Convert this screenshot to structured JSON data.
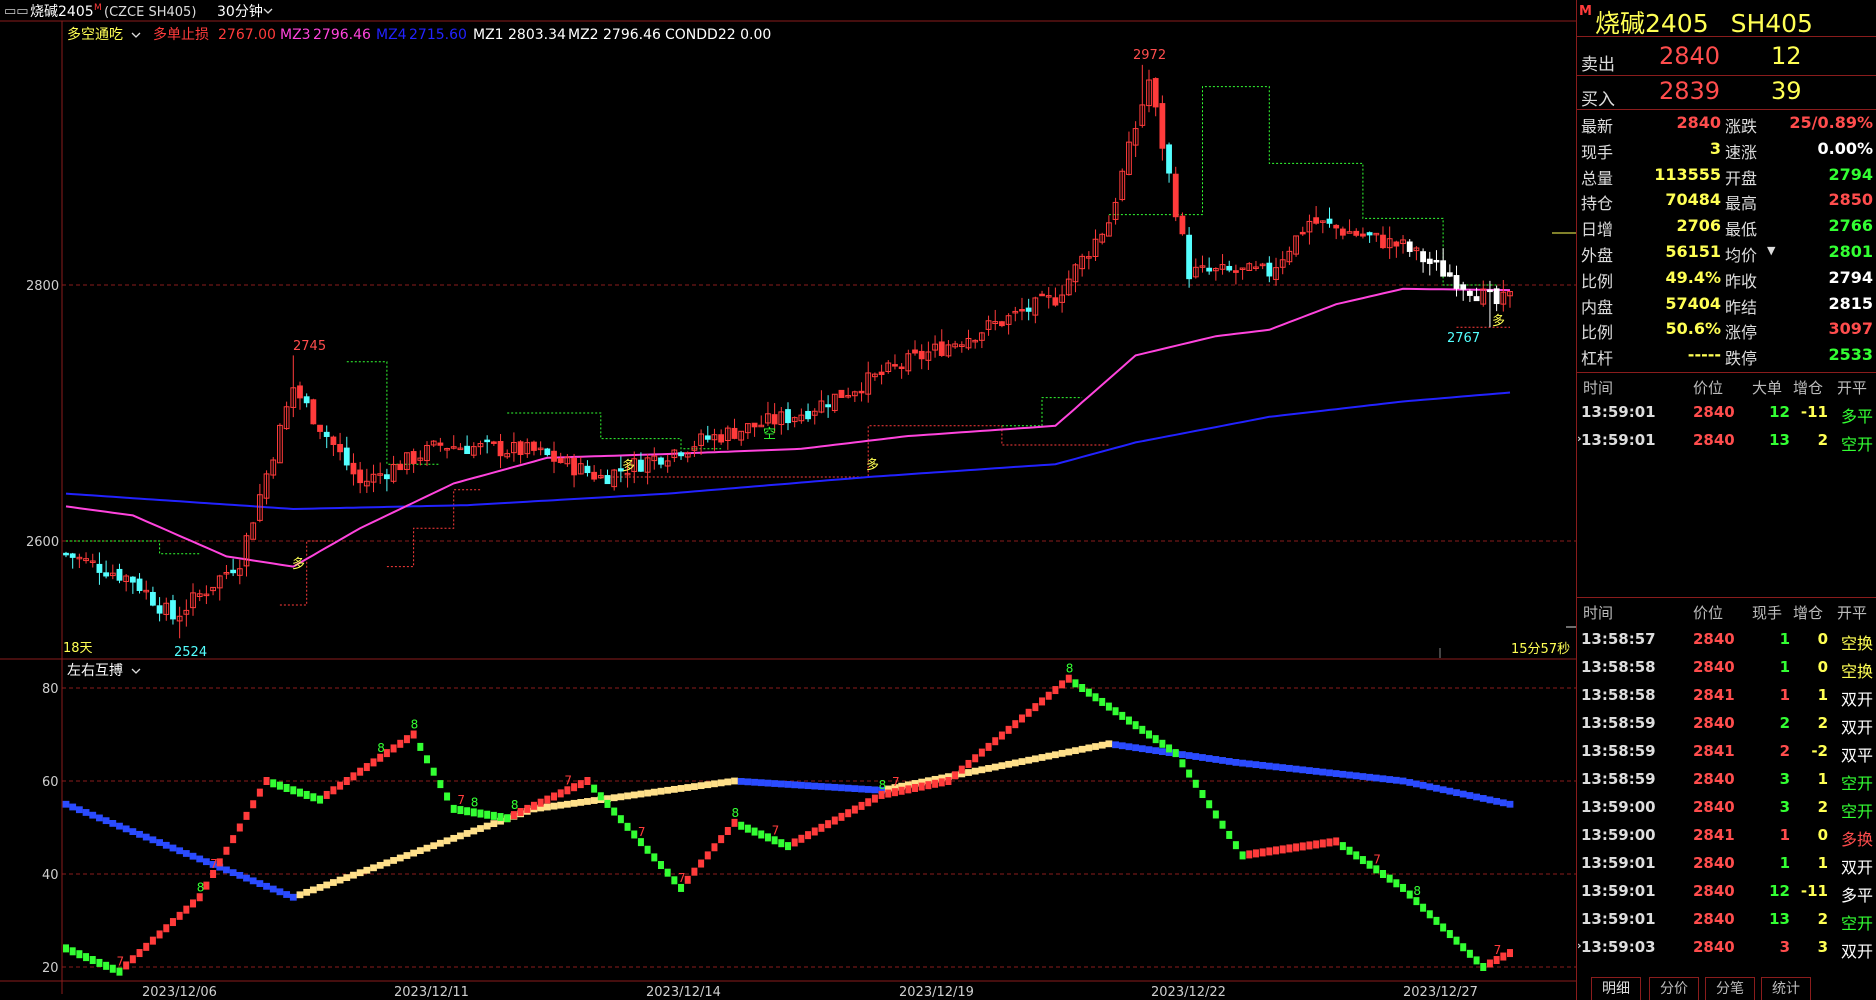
{
  "window": {
    "title_prefix": "烧碱2405",
    "title_suffix": "(CZCE SH405)",
    "period": "30分钟"
  },
  "colors": {
    "up": "#ff3b3b",
    "down": "#54ffff",
    "ma3": "#ff44dd",
    "ma4": "#2222ff",
    "yellow": "#ffff54",
    "green": "#33ff33",
    "grid": "#8a1c1c"
  },
  "indicator_line": {
    "name": "多空通吃",
    "stop_label": "多单止损",
    "stop_value": "2767.00",
    "mz3_label": "MZ3",
    "mz3_value": "2796.46",
    "mz4_label": "MZ4",
    "mz4_value": "2715.60",
    "mz1": "MZ1 2803.34",
    "mz2": "MZ2 2796.46",
    "cond": "CONDD22 0.00"
  },
  "main_chart": {
    "y_ticks": [
      "2800",
      "2600"
    ],
    "max_label": "2972",
    "local_max_label": "2745",
    "min_label": "2524",
    "recent_low_label": "2767",
    "days_label": "18天",
    "countdown": "15分57秒",
    "signal_long": "多",
    "signal_short": "空"
  },
  "sub_chart": {
    "name": "左右互搏",
    "y_ticks": [
      "80",
      "60",
      "40",
      "20"
    ]
  },
  "x_dates": [
    "2023/12/06",
    "2023/12/11",
    "2023/12/14",
    "2023/12/19",
    "2023/12/22",
    "2023/12/27"
  ],
  "chart_data": [
    {
      "type": "candlestick",
      "title": "烧碱2405 (CZCE SH405) 30分钟",
      "y_ticks": [
        2600,
        2800
      ],
      "ohlc_keypoints": [
        [
          0,
          2590
        ],
        [
          10,
          2570
        ],
        [
          16,
          2540
        ],
        [
          26,
          2585
        ],
        [
          34,
          2720
        ],
        [
          44,
          2645
        ],
        [
          56,
          2675
        ],
        [
          70,
          2670
        ],
        [
          80,
          2650
        ],
        [
          96,
          2680
        ],
        [
          110,
          2700
        ],
        [
          126,
          2740
        ],
        [
          148,
          2790
        ],
        [
          156,
          2850
        ],
        [
          162,
          2960
        ],
        [
          168,
          2810
        ],
        [
          180,
          2810
        ],
        [
          186,
          2850
        ],
        [
          200,
          2830
        ],
        [
          214,
          2785
        ],
        [
          220,
          2800
        ],
        [
          226,
          2840
        ]
      ],
      "annotations": {
        "high": 2972,
        "peak2": 2745,
        "low": 2524,
        "recent_low": 2767
      },
      "series": [
        {
          "name": "MZ3",
          "last": 2796.46
        },
        {
          "name": "MZ4",
          "last": 2715.6
        },
        {
          "name": "MZ1",
          "last": 2803.34
        },
        {
          "name": "MZ2",
          "last": 2796.46
        },
        {
          "name": "多单止损",
          "last": 2767.0
        }
      ]
    },
    {
      "type": "line",
      "title": "左右互搏",
      "y_ticks": [
        80,
        60,
        40,
        20
      ],
      "series": [
        {
          "values_keypoints": [
            [
              0,
              24
            ],
            [
              8,
              19
            ],
            [
              20,
              35
            ],
            [
              30,
              60
            ],
            [
              38,
              56
            ],
            [
              52,
              70
            ],
            [
              58,
              54
            ],
            [
              66,
              52
            ],
            [
              78,
              60
            ],
            [
              92,
              37
            ],
            [
              100,
              51
            ],
            [
              108,
              46
            ],
            [
              122,
              57
            ],
            [
              132,
              60
            ],
            [
              150,
              82
            ],
            [
              166,
              66
            ],
            [
              176,
              44
            ],
            [
              190,
              47
            ],
            [
              200,
              37
            ],
            [
              212,
              20
            ],
            [
              216,
              23
            ]
          ]
        },
        {
          "values_keypoints": [
            [
              0,
              55
            ],
            [
              34,
              35
            ],
            [
              70,
              54
            ],
            [
              100,
              60
            ],
            [
              122,
              58
            ],
            [
              156,
              68
            ],
            [
              175,
              64
            ],
            [
              200,
              60
            ],
            [
              216,
              55
            ]
          ]
        }
      ]
    }
  ],
  "quote": {
    "symbol": "烧碱2405",
    "code": "SH405",
    "flag": "M",
    "ask_label": "卖出",
    "ask_price": "2840",
    "ask_vol": "12",
    "bid_label": "买入",
    "bid_price": "2839",
    "bid_vol": "39",
    "rows": [
      {
        "k1": "最新",
        "v1": "2840",
        "c1": "#ff4d4d",
        "k2": "涨跌",
        "v2": "25/0.89%",
        "c2": "#ff4d4d"
      },
      {
        "k1": "现手",
        "v1": "3",
        "c1": "#ffff54",
        "k2": "速涨",
        "v2": "0.00%",
        "c2": "#ffffff"
      },
      {
        "k1": "总量",
        "v1": "113555",
        "c1": "#ffff54",
        "k2": "开盘",
        "v2": "2794",
        "c2": "#33ff33"
      },
      {
        "k1": "持仓",
        "v1": "70484",
        "c1": "#ffff54",
        "k2": "最高",
        "v2": "2850",
        "c2": "#ff4d4d"
      },
      {
        "k1": "日增",
        "v1": "2706",
        "c1": "#ffff54",
        "k2": "最低",
        "v2": "2766",
        "c2": "#33ff33"
      },
      {
        "k1": "外盘",
        "v1": "56151",
        "c1": "#ffff54",
        "k2": "均价",
        "v2": "2801",
        "c2": "#33ff33"
      },
      {
        "k1": "比例",
        "v1": "49.4%",
        "c1": "#ffff54",
        "k2": "昨收",
        "v2": "2794",
        "c2": "#ffffff"
      },
      {
        "k1": "内盘",
        "v1": "57404",
        "c1": "#ffff54",
        "k2": "昨结",
        "v2": "2815",
        "c2": "#ffffff"
      },
      {
        "k1": "比例",
        "v1": "50.6%",
        "c1": "#ffff54",
        "k2": "涨停",
        "v2": "3097",
        "c2": "#ff4d4d"
      },
      {
        "k1": "杠杆",
        "v1": "-----",
        "c1": "#ffff54",
        "k2": "跌停",
        "v2": "2533",
        "c2": "#33ff33"
      }
    ]
  },
  "big_header": {
    "time": "时间",
    "price": "价位",
    "vol": "大单",
    "chg": "增仓",
    "type": "开平"
  },
  "big_trades": [
    {
      "time": "13:59:01",
      "price": "2840",
      "vol": "12",
      "chg": "-11",
      "type": "多平",
      "vc": "#33ff33",
      "cc": "#ffff54",
      "tc": "#33ff33"
    },
    {
      "time": "13:59:01",
      "price": "2840",
      "vol": "13",
      "chg": "2",
      "type": "空开",
      "vc": "#33ff33",
      "cc": "#ffff54",
      "tc": "#33ff33"
    }
  ],
  "tick_header": {
    "time": "时间",
    "price": "价位",
    "vol": "现手",
    "chg": "增仓",
    "type": "开平"
  },
  "ticks": [
    {
      "time": "13:58:57",
      "price": "2840",
      "vol": "1",
      "chg": "0",
      "type": "空换",
      "vc": "#33ff33",
      "cc": "#ffff54",
      "tc": "#ffff54"
    },
    {
      "time": "13:58:58",
      "price": "2840",
      "vol": "1",
      "chg": "0",
      "type": "空换",
      "vc": "#33ff33",
      "cc": "#ffff54",
      "tc": "#ffff54"
    },
    {
      "time": "13:58:58",
      "price": "2841",
      "vol": "1",
      "chg": "1",
      "type": "双开",
      "vc": "#ff4d4d",
      "cc": "#ffff54",
      "tc": "#ffffff"
    },
    {
      "time": "13:58:59",
      "price": "2840",
      "vol": "2",
      "chg": "2",
      "type": "双开",
      "vc": "#33ff33",
      "cc": "#ffff54",
      "tc": "#ffffff"
    },
    {
      "time": "13:58:59",
      "price": "2841",
      "vol": "2",
      "chg": "-2",
      "type": "双平",
      "vc": "#ff4d4d",
      "cc": "#ffff54",
      "tc": "#ffffff"
    },
    {
      "time": "13:58:59",
      "price": "2840",
      "vol": "3",
      "chg": "1",
      "type": "空开",
      "vc": "#33ff33",
      "cc": "#ffff54",
      "tc": "#33ff33"
    },
    {
      "time": "13:59:00",
      "price": "2840",
      "vol": "3",
      "chg": "2",
      "type": "空开",
      "vc": "#33ff33",
      "cc": "#ffff54",
      "tc": "#33ff33"
    },
    {
      "time": "13:59:00",
      "price": "2841",
      "vol": "1",
      "chg": "0",
      "type": "多换",
      "vc": "#ff4d4d",
      "cc": "#ffff54",
      "tc": "#ff4d4d"
    },
    {
      "time": "13:59:01",
      "price": "2840",
      "vol": "1",
      "chg": "1",
      "type": "双开",
      "vc": "#33ff33",
      "cc": "#ffff54",
      "tc": "#ffffff"
    },
    {
      "time": "13:59:01",
      "price": "2840",
      "vol": "12",
      "chg": "-11",
      "type": "多平",
      "vc": "#33ff33",
      "cc": "#ffff54",
      "tc": "#ffffff"
    },
    {
      "time": "13:59:01",
      "price": "2840",
      "vol": "13",
      "chg": "2",
      "type": "空开",
      "vc": "#33ff33",
      "cc": "#ffff54",
      "tc": "#33ff33"
    },
    {
      "time": "13:59:03",
      "price": "2840",
      "vol": "3",
      "chg": "3",
      "type": "双开",
      "vc": "#ff4d4d",
      "cc": "#ffff54",
      "tc": "#ffffff"
    }
  ],
  "tabs": [
    "明细",
    "分价",
    "分笔",
    "统计"
  ]
}
